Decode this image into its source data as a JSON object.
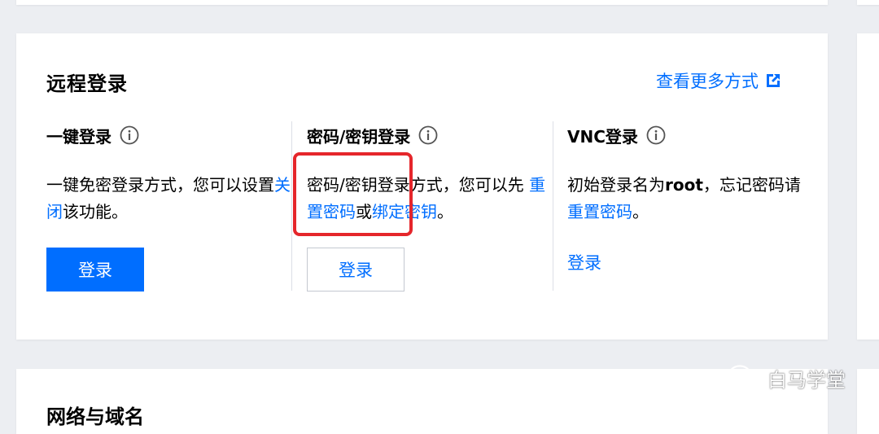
{
  "section": {
    "title": "远程登录",
    "more_link": "查看更多方式"
  },
  "columns": [
    {
      "heading": "一键登录",
      "desc_parts": [
        "一键免密登录方式，您可以设置",
        "关闭",
        "该功能。"
      ],
      "button": "登录"
    },
    {
      "heading": "密码/密钥登录",
      "desc_parts": [
        "密码/密钥登录方式，您可以先 ",
        "重置密码",
        "或",
        "绑定密钥",
        "。"
      ],
      "button": "登录"
    },
    {
      "heading": "VNC登录",
      "desc_parts": [
        "初始登录名为",
        "root",
        "，忘记密码请",
        "重置密码",
        "。"
      ],
      "button": "登录"
    }
  ],
  "next_section": {
    "title": "网络与域名"
  },
  "watermark": {
    "text": "白马学堂"
  },
  "colors": {
    "accent": "#006eff",
    "highlight": "#e5262b",
    "background": "#eceef2"
  }
}
